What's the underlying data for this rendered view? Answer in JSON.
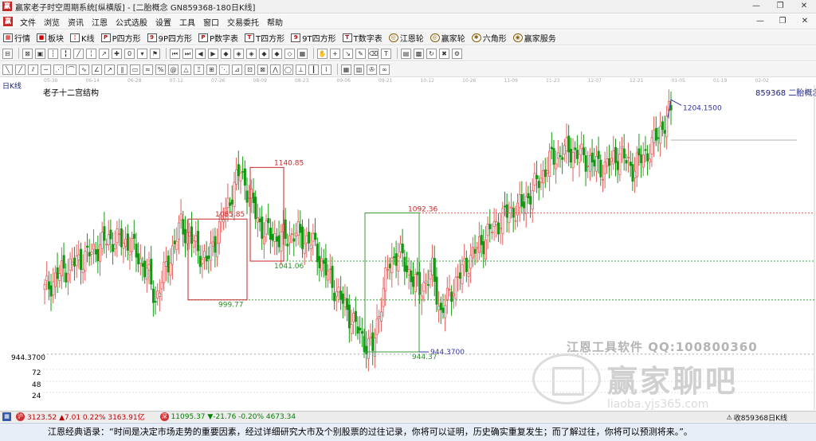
{
  "window": {
    "title": "赢家老子时空周期系统[纵横版] - [二胎概念  GN859368-180日K线]",
    "controls": [
      "—",
      "❐",
      "✕"
    ]
  },
  "menubar": {
    "items": [
      "文件",
      "浏览",
      "资讯",
      "江恩",
      "公式选股",
      "设置",
      "工具",
      "窗口",
      "交易委托",
      "帮助"
    ],
    "right_controls": [
      "—",
      "❐",
      "✕"
    ]
  },
  "toolbar1": {
    "items": [
      {
        "label": "行情",
        "icon": "grid-icon"
      },
      {
        "label": "板块",
        "icon": "sector-icon"
      },
      {
        "label": "K线",
        "icon": "kline-icon"
      },
      {
        "label": "P四方形",
        "icon": "p-square-icon"
      },
      {
        "label": "9P四方形",
        "icon": "9p-square-icon"
      },
      {
        "label": "P数字表",
        "icon": "pn-table-icon"
      },
      {
        "label": "T四方形",
        "icon": "t-square-icon"
      },
      {
        "label": "9T四方形",
        "icon": "9t-square-icon"
      },
      {
        "label": "T数字表",
        "icon": "tn-table-icon"
      },
      {
        "label": "江恩轮",
        "icon": "gann-wheel-icon"
      },
      {
        "label": "赢家轮",
        "icon": "winner-wheel-icon"
      },
      {
        "label": "六角形",
        "icon": "hexagon-icon"
      },
      {
        "label": "赢家服务",
        "icon": "service-icon"
      }
    ]
  },
  "chart_header": {
    "period": "日K线",
    "title": "老子十二宫结构",
    "code": "859368  二胎概念",
    "date_ticks": [
      "05-30",
      "06-14",
      "06-28",
      "07-12",
      "07-26",
      "08-09",
      "08-23",
      "09-06",
      "09-21",
      "10-12",
      "10-26",
      "11-09",
      "11-23",
      "12-07",
      "12-21",
      "01-05",
      "01-19",
      "02-02"
    ]
  },
  "chart_data": {
    "type": "candlestick",
    "title": "老子十二宫结构",
    "price_axis_label": "944.3700",
    "volume_ticks": [
      "72",
      "48",
      "24"
    ],
    "price_range": [
      944.37,
      1204.15
    ],
    "annotations": {
      "high_label": "1204.1500",
      "low_label": "944.3700",
      "levels": [
        "1140.85",
        "1092.36",
        "1085.85",
        "1041.06",
        "999.77",
        "944.37"
      ]
    },
    "level_lines": [
      {
        "value": 1092.36,
        "color": "#e06060"
      },
      {
        "value": 1041.06,
        "color": "#39a839"
      },
      {
        "value": 999.77,
        "color": "#39a839"
      }
    ],
    "boxes": [
      {
        "from": 1085.85,
        "to": 999.77,
        "color": "#c62828"
      },
      {
        "from": 1140.85,
        "to": 1041.06,
        "color": "#c62828"
      },
      {
        "from": 1092.36,
        "to": 944.37,
        "color": "#3a9a3a"
      }
    ]
  },
  "statusbar": {
    "index1_icon": "沪",
    "index1_text": "3123.52  ▲7.01  0.22%  3163.91亿",
    "index2_icon": "深",
    "index2_text": "11095.37  ▼-21.76  -0.20%  4673.34",
    "right_text": "收859368日K线"
  },
  "quotebar": {
    "text": "江恩经典语录：“时间是决定市场走势的重要因素，经过详细研究大市及个别股票的过往记录，你将可以证明，历史确实重复发生；而了解过往，你将可以预测将来。”。"
  },
  "watermark": {
    "brand": "江恩工具软件   QQ:100800360",
    "name": "赢家聊吧",
    "url": "liaoba.yjs365.com"
  },
  "colors": {
    "up": "#e06060",
    "down": "#119911",
    "high_line": "#3333aa",
    "background": "#ffffff"
  }
}
